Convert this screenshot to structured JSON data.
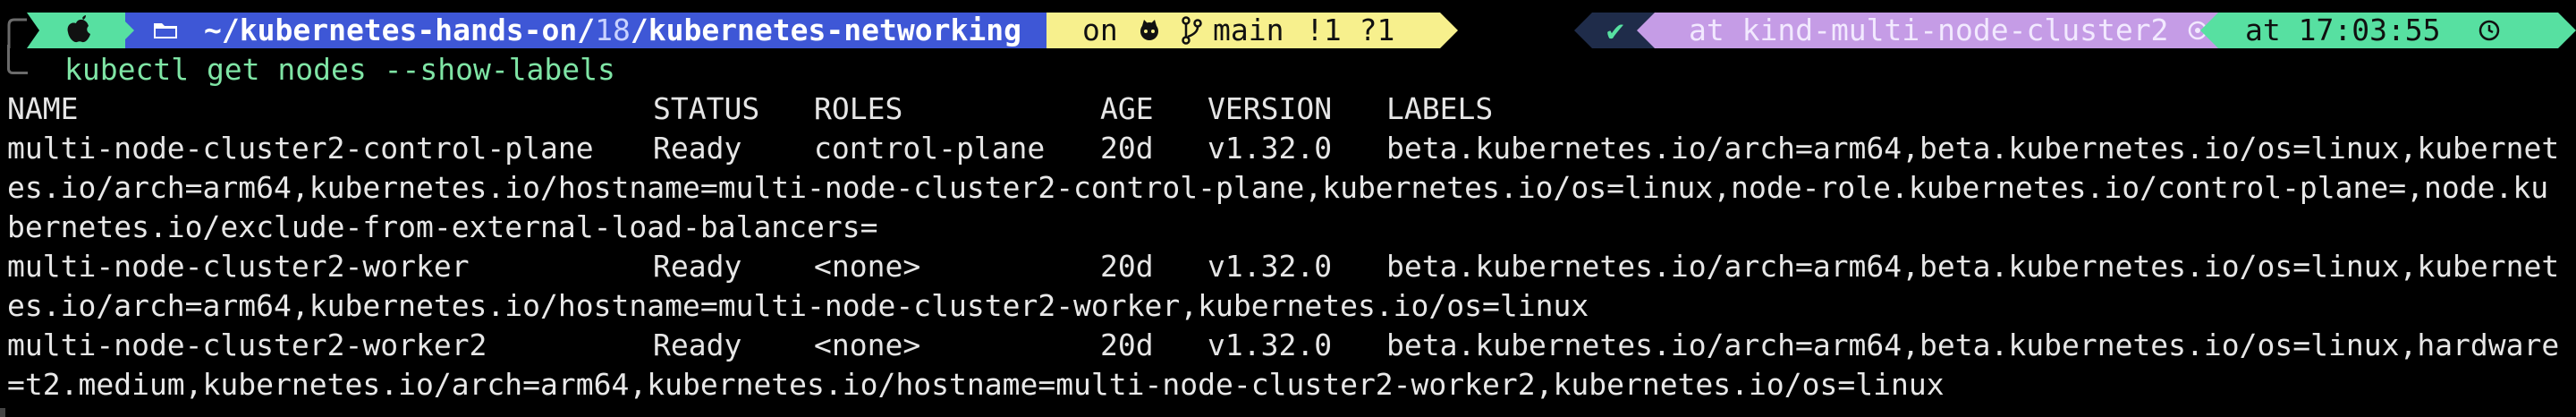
{
  "prompt": {
    "path_prefix": "~/kubernetes-hands-on/",
    "path_number": "18",
    "path_suffix": "/kubernetes-networking",
    "git_on": "on",
    "git_branch": "main",
    "git_status": "!1 ?1",
    "status_check": "✔",
    "context": "at kind-multi-node-cluster2",
    "time": "at 17:03:55",
    "icons": [
      "apple-icon",
      "folder-icon",
      "github-icon",
      "git-branch-icon",
      "k8s-helm-icon",
      "clock-icon"
    ],
    "colors": {
      "green": "#57e0a1",
      "blue": "#3e57d6",
      "yellow": "#f7f08d",
      "purple": "#c59ce6",
      "navy": "#1f2c4a"
    }
  },
  "command": "kubectl get nodes --show-labels",
  "table": {
    "headers": [
      "NAME",
      "STATUS",
      "ROLES",
      "AGE",
      "VERSION",
      "LABELS"
    ],
    "rows": [
      {
        "name": "multi-node-cluster2-control-plane",
        "status": "Ready",
        "roles": "control-plane",
        "age": "20d",
        "version": "v1.32.0",
        "labels_line1": "beta.kubernetes.io/arch=arm64,beta.kubernetes.io/os=linux,kubernet",
        "labels_line2": "es.io/arch=arm64,kubernetes.io/hostname=multi-node-cluster2-control-plane,kubernetes.io/os=linux,node-role.kubernetes.io/control-plane=,node.ku",
        "labels_line3": "bernetes.io/exclude-from-external-load-balancers="
      },
      {
        "name": "multi-node-cluster2-worker",
        "status": "Ready",
        "roles": "<none>",
        "age": "20d",
        "version": "v1.32.0",
        "labels_line1": "beta.kubernetes.io/arch=arm64,beta.kubernetes.io/os=linux,kubernet",
        "labels_line2": "es.io/arch=arm64,kubernetes.io/hostname=multi-node-cluster2-worker,kubernetes.io/os=linux"
      },
      {
        "name": "multi-node-cluster2-worker2",
        "status": "Ready",
        "roles": "<none>",
        "age": "20d",
        "version": "v1.32.0",
        "labels_line1": "beta.kubernetes.io/arch=arm64,beta.kubernetes.io/os=linux,hardware",
        "labels_line2": "=t2.medium,kubernetes.io/arch=arm64,kubernetes.io/hostname=multi-node-cluster2-worker2,kubernetes.io/os=linux"
      }
    ]
  }
}
